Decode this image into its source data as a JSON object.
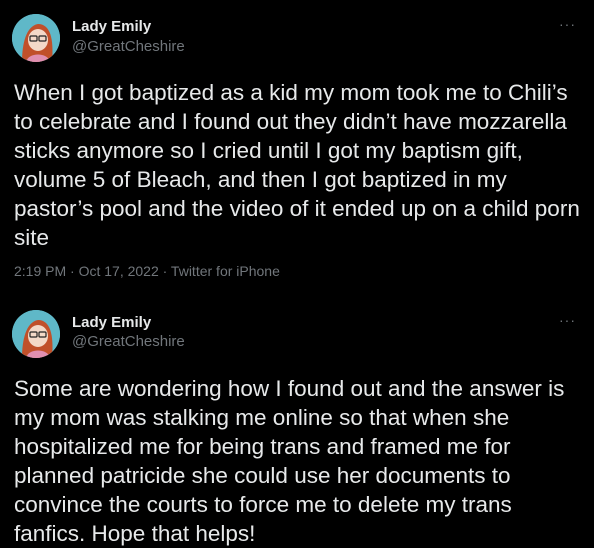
{
  "tweets": [
    {
      "name": "Lady Emily",
      "handle": "@GreatCheshire",
      "more": "···",
      "text": "When I got baptized as a kid my mom took me to Chili’s to celebrate and I found out they didn’t have mozzarella sticks anymore so I cried until I got my baptism gift, volume 5 of Bleach, and then I got baptized in my pastor’s pool and the video of it ended up on a child porn site",
      "meta": "2:19 PM · Oct 17, 2022 · Twitter for iPhone"
    },
    {
      "name": "Lady Emily",
      "handle": "@GreatCheshire",
      "more": "···",
      "text": "Some are wondering how I found out and the answer is my mom was stalking me online so that when she hospitalized me for being trans and framed me for planned patricide she could use her documents to convince the courts to force me to delete my trans fanfics. Hope that helps!"
    }
  ],
  "colors": {
    "background": "#000000",
    "text": "#e7e9ea",
    "secondary": "#71767b",
    "avatar_bg": "#5fb8c8",
    "avatar_hair": "#c0502a"
  },
  "icons": [
    "avatar-illustration",
    "more-options-icon"
  ]
}
